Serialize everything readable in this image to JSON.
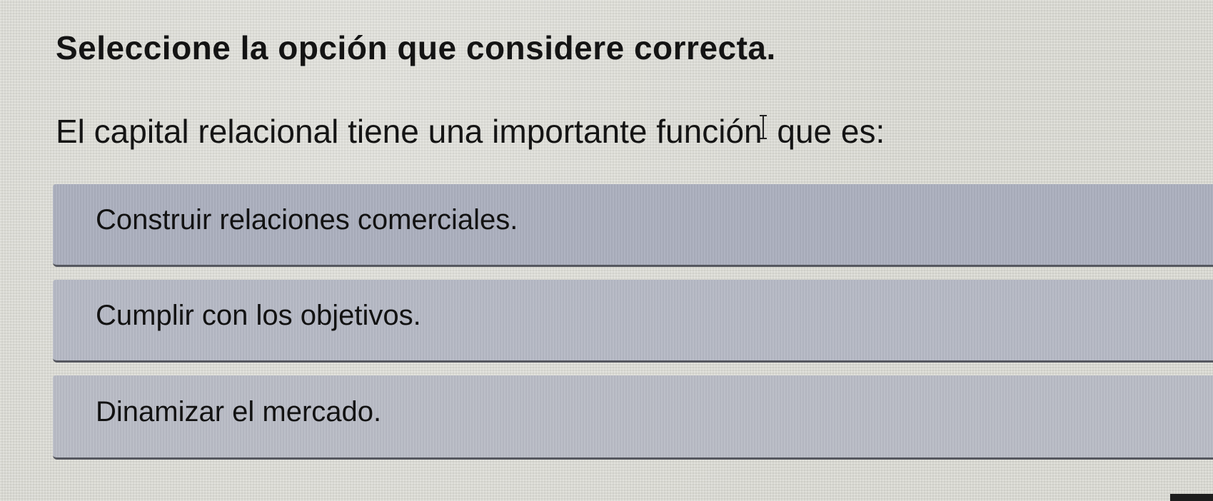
{
  "question": {
    "instruction": "Seleccione la opción que considere correcta.",
    "prompt_before_cursor": "El capital relacional tiene una importante función",
    "prompt_after_cursor": " que es:"
  },
  "options": [
    {
      "label": "Construir relaciones comerciales."
    },
    {
      "label": "Cumplir con los objetivos."
    },
    {
      "label": "Dinamizar el mercado."
    }
  ],
  "colors": {
    "background": "#dbdbd4",
    "option_background": "#a9adbc",
    "option_border": "#55575f",
    "text": "#141414"
  },
  "icons": {
    "cursor": "text-cursor-icon"
  }
}
